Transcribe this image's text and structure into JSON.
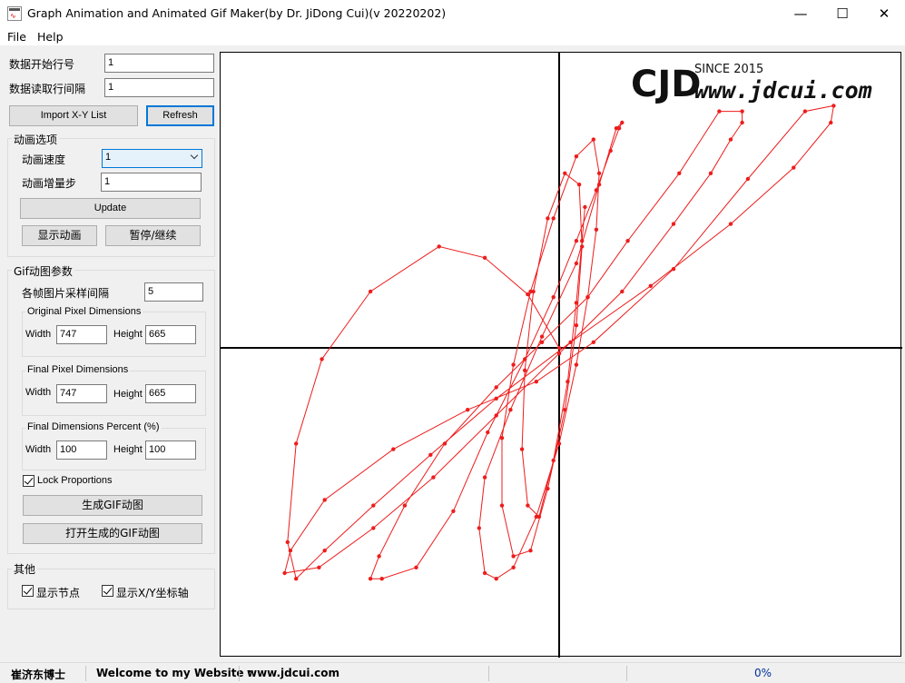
{
  "window": {
    "title": "Graph Animation and Animated Gif Maker(by Dr. JiDong Cui)(v 20220202)",
    "min_glyph": "—",
    "max_glyph": "☐",
    "close_glyph": "✕"
  },
  "menu": {
    "file": "File",
    "help": "Help"
  },
  "data_options": {
    "start_row_label": "数据开始行号",
    "start_row_value": "1",
    "interval_label": "数据读取行间隔",
    "interval_value": "1",
    "import_button": "Import X-Y List",
    "refresh_button": "Refresh"
  },
  "animation": {
    "group_title": "动画选项",
    "speed_label": "动画速度",
    "speed_value": "1",
    "step_label": "动画增量步",
    "step_value": "1",
    "update_button": "Update",
    "show_button": "显示动画",
    "pause_button": "暂停/继续"
  },
  "gif": {
    "group_title": "Gif动图参数",
    "sample_label": "各帧图片采样间隔",
    "sample_value": "5",
    "original": {
      "title": "Original Pixel Dimensions",
      "width_label": "Width",
      "width": "747",
      "height_label": "Height",
      "height": "665"
    },
    "final": {
      "title": "Final Pixel Dimensions",
      "width_label": "Width",
      "width": "747",
      "height_label": "Height",
      "height": "665"
    },
    "percent": {
      "title": "Final Dimensions Percent (%)",
      "width_label": "Width",
      "width": "100",
      "height_label": "Height",
      "height": "100"
    },
    "lock_label": "Lock Proportions",
    "lock_checked": true,
    "generate_button": "生成GIF动图",
    "open_button": "打开生成的GIF动图"
  },
  "other": {
    "group_title": "其他",
    "show_nodes_label": "显示节点",
    "show_nodes_checked": true,
    "show_axes_label": "显示X/Y坐标轴",
    "show_axes_checked": true
  },
  "watermark": {
    "letters": "CJD",
    "since": "SINCE 2015",
    "site": "www.jdcui.com"
  },
  "status": {
    "author": "崔济东博士",
    "welcome": "Welcome to my Website :",
    "site": "www.jdcui.com",
    "progress": "0%"
  },
  "colors": {
    "curve": "#ee1c1c",
    "axis": "#000000",
    "focus": "#0078d7"
  },
  "chart_data": {
    "type": "line",
    "axes_visible": true,
    "x": [
      0,
      -0.11,
      -0.26,
      -0.42,
      -0.66,
      -0.83,
      -0.92,
      -0.95,
      -0.92,
      -0.82,
      -0.65,
      -0.45,
      -0.22,
      0.04,
      0.32,
      0.6,
      0.82,
      0.95,
      0.96,
      0.86,
      0.66,
      0.4,
      0.12,
      -0.08,
      -0.32,
      -0.58,
      -0.82,
      -0.94,
      -0.96,
      -0.84,
      -0.65,
      -0.44,
      -0.22,
      0.0,
      0.22,
      0.4,
      0.53,
      0.6,
      0.64,
      0.64,
      0.56,
      0.42,
      0.24,
      0.1,
      -0.06,
      -0.22,
      -0.4,
      -0.54,
      -0.63,
      -0.66,
      -0.62,
      -0.5,
      -0.37,
      -0.25,
      -0.12,
      -0.02,
      0.06,
      0.13,
      0.18,
      0.21,
      0.22,
      0.2,
      0.14,
      0.06,
      -0.06,
      -0.17,
      -0.26,
      -0.28,
      -0.26,
      -0.22,
      -0.16,
      -0.08,
      0.0,
      0.06,
      0.1,
      0.13,
      0.14,
      0.12,
      0.06,
      -0.02,
      -0.1,
      -0.16,
      -0.2,
      -0.2,
      -0.16,
      -0.1,
      -0.04,
      0.02,
      0.06,
      0.08,
      0.07,
      0.02,
      -0.04,
      -0.09,
      -0.12,
      -0.13,
      -0.11,
      -0.07,
      -0.02,
      0.03,
      0.06,
      0.08,
      0.09
    ],
    "y": [
      0,
      0.19,
      0.32,
      0.36,
      0.2,
      -0.04,
      -0.34,
      -0.69,
      -0.82,
      -0.72,
      -0.56,
      -0.38,
      -0.18,
      0.02,
      0.22,
      0.44,
      0.64,
      0.8,
      0.86,
      0.84,
      0.6,
      0.28,
      0.02,
      -0.12,
      -0.22,
      -0.36,
      -0.54,
      -0.72,
      -0.8,
      -0.78,
      -0.64,
      -0.46,
      -0.24,
      -0.02,
      0.2,
      0.44,
      0.62,
      0.74,
      0.8,
      0.84,
      0.84,
      0.62,
      0.38,
      0.18,
      0.02,
      -0.14,
      -0.34,
      -0.56,
      -0.74,
      -0.82,
      -0.82,
      -0.78,
      -0.58,
      -0.3,
      -0.04,
      0.18,
      0.38,
      0.56,
      0.7,
      0.78,
      0.8,
      0.78,
      0.58,
      0.3,
      0.04,
      -0.22,
      -0.46,
      -0.64,
      -0.8,
      -0.82,
      -0.78,
      -0.6,
      -0.34,
      -0.06,
      0.18,
      0.42,
      0.62,
      0.74,
      0.68,
      0.46,
      0.2,
      -0.06,
      -0.32,
      -0.56,
      -0.74,
      -0.72,
      -0.5,
      -0.22,
      0.08,
      0.36,
      0.58,
      0.62,
      0.46,
      0.2,
      -0.08,
      -0.36,
      -0.56,
      -0.6,
      -0.4,
      -0.12,
      0.16,
      0.38,
      0.5
    ]
  }
}
